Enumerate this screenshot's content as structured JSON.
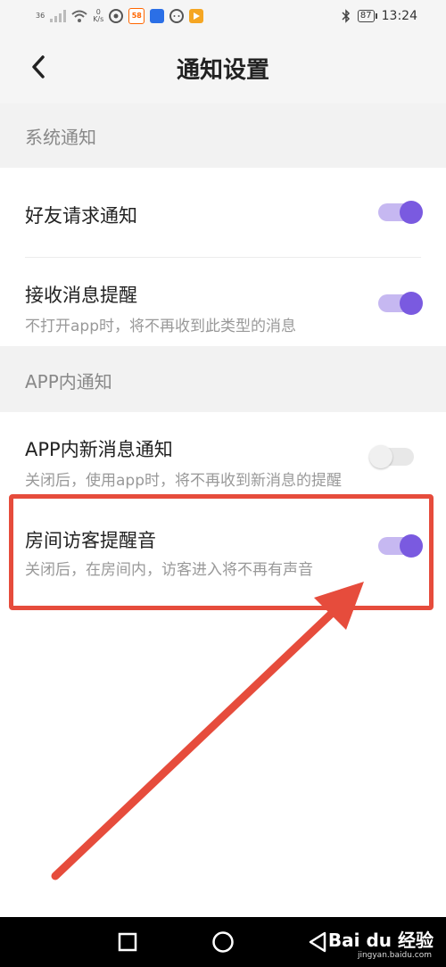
{
  "status_bar": {
    "network_label": "36",
    "speed_value": "0",
    "speed_unit": "K/s",
    "app_badge": "58",
    "battery": "87",
    "time": "13:24"
  },
  "header": {
    "title": "通知设置"
  },
  "sections": {
    "system": {
      "label": "系统通知",
      "items": [
        {
          "title": "好友请求通知",
          "subtitle": "",
          "enabled": true
        },
        {
          "title": "接收消息提醒",
          "subtitle": "不打开app时，将不再收到此类型的消息",
          "enabled": true
        }
      ]
    },
    "app": {
      "label": "APP内通知",
      "items": [
        {
          "title": "APP内新消息通知",
          "subtitle": "关闭后，使用app时，将不再收到新消息的提醒",
          "enabled": false
        },
        {
          "title": "房间访客提醒音",
          "subtitle": "关闭后，在房间内，访客进入将不再有声音",
          "enabled": true
        }
      ]
    }
  },
  "colors": {
    "toggle_on": "#7a5ae0",
    "toggle_on_track": "#c6b8f1",
    "highlight": "#e64c3c"
  },
  "watermark": {
    "brand": "Bai du 经验",
    "url": "jingyan.baidu.com"
  }
}
